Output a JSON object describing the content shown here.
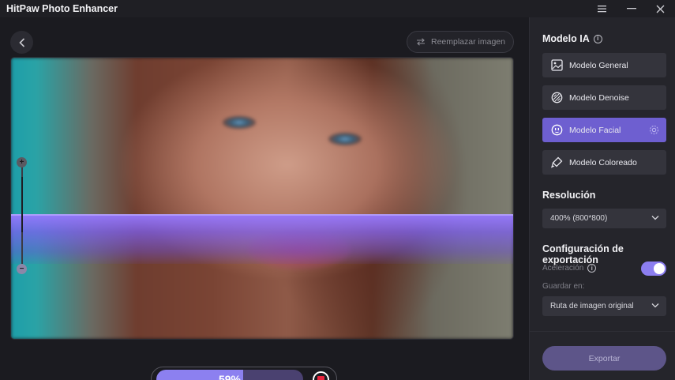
{
  "app": {
    "title": "HitPaw Photo Enhancer"
  },
  "window_controls": [
    {
      "name": "menu-icon"
    },
    {
      "name": "minimize-icon"
    },
    {
      "name": "close-icon"
    }
  ],
  "toolbar": {
    "back_icon": "chevron-left-icon",
    "replace_label": "Reemplazar imagen",
    "replace_icon": "swap-arrows-icon"
  },
  "preview": {
    "zoom_in_symbol": "+",
    "zoom_out_symbol": "−",
    "progress": {
      "percent_value": 59,
      "percent_label": "59%"
    },
    "stop_icon": "stop-icon",
    "scan_color": "#8c80f0"
  },
  "sidebar": {
    "model_title": "Modelo IA",
    "models": [
      {
        "label": "Modelo General",
        "icon": "image-icon",
        "active": false
      },
      {
        "label": "Modelo Denoise",
        "icon": "denoise-icon",
        "active": false
      },
      {
        "label": "Modelo Facial",
        "icon": "face-icon",
        "active": true
      },
      {
        "label": "Modelo Coloreado",
        "icon": "brush-icon",
        "active": false
      }
    ],
    "resolution_title": "Resolución",
    "resolution_value": "400% (800*800)",
    "export_title": "Configuración de exportación",
    "acceleration_label": "Aceleración",
    "acceleration_on": true,
    "save_label": "Guardar en:",
    "save_value": "Ruta de imagen original",
    "export_button": "Exportar"
  },
  "colors": {
    "accent": "#6e5fd0",
    "toggle": "#8c7ef0",
    "stop": "#e8243d",
    "background": "#1b1b20",
    "panel": "#25252b"
  }
}
